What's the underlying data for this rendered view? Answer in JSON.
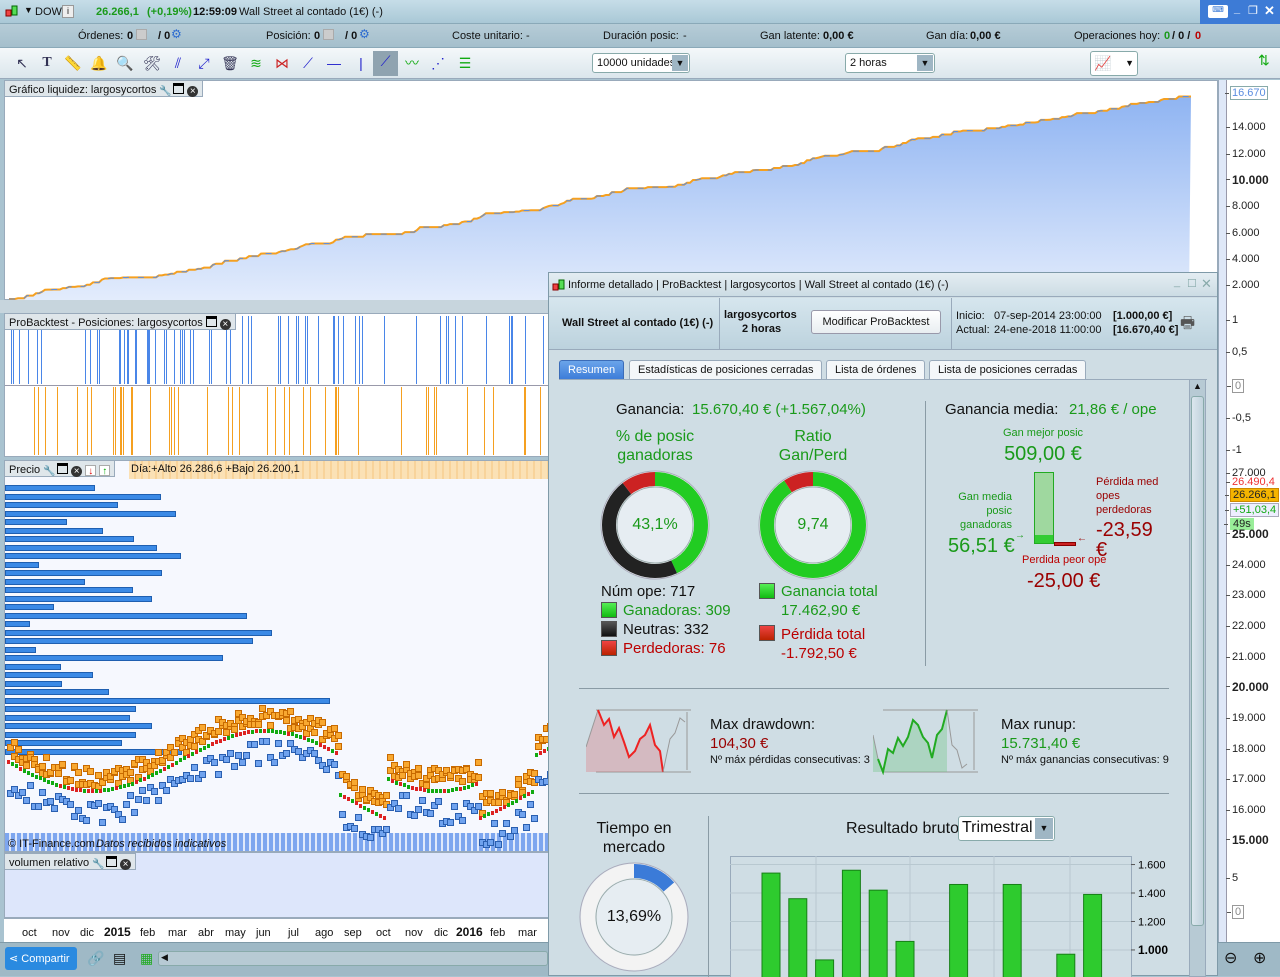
{
  "title_bar": {
    "symbol": "DOW",
    "price": "26.266,1",
    "change": "(+0,19%)",
    "time": "12:59:09",
    "instrument": "Wall Street al contado (1€) (-)"
  },
  "status_bar": {
    "ordenes_label": "Órdenes:",
    "ordenes_value": "0",
    "ordenes_total": "/ 0",
    "posicion_label": "Posición:",
    "posicion_value": "0",
    "posicion_total": "/ 0",
    "coste_label": "Coste unitario:",
    "coste_value": "-",
    "duracion_label": "Duración posic:",
    "duracion_value": "-",
    "gan_latente_label": "Gan latente:",
    "gan_latente_value": "0,00 €",
    "gan_dia_label": "Gan día:",
    "gan_dia_value": "0,00 €",
    "operaciones_label": "Operaciones hoy:",
    "ops": [
      "0",
      "/ 0 /",
      "0"
    ]
  },
  "toolbar": {
    "units": "10000 unidades",
    "timeframe": "2 horas"
  },
  "panels": {
    "equity_title": "Gráfico liquidez: largosycortos",
    "positions_title": "ProBacktest - Posiciones: largosycortos",
    "price_title": "Precio",
    "price_info": "Día:+Alto 26.286,6 +Bajo 26.200,1",
    "copyright": "© IT-Finance.com",
    "data_note": "Datos recibidos indicativos",
    "volume_title": "volumen relativo"
  },
  "axes": {
    "equity": [
      "16.670",
      "14.000",
      "12.000",
      "10.000",
      "8.000",
      "6.000",
      "4.000",
      "2.000"
    ],
    "positions": [
      "1",
      "0,5",
      "0",
      "-0,5",
      "-1"
    ],
    "price": [
      "27.000",
      "26.490,4",
      "26.266,1",
      "+51,03,4",
      "49s",
      "25.000",
      "24.000",
      "23.000",
      "22.000",
      "21.000",
      "20.000",
      "19.000",
      "18.000",
      "17.000",
      "16.000",
      "15.000"
    ],
    "volume": [
      "5",
      "0"
    ],
    "dates": [
      "oct",
      "nov",
      "dic",
      "2015",
      "feb",
      "mar",
      "abr",
      "may",
      "jun",
      "jul",
      "ago",
      "sep",
      "oct",
      "nov",
      "dic",
      "2016",
      "feb",
      "mar"
    ]
  },
  "bottom_bar": {
    "share_label": "Compartir"
  },
  "report": {
    "title": "Informe detallado | ProBacktest | largosycortos | Wall Street al contado (1€) (-)",
    "instrument": "Wall Street al contado (1€) (-)",
    "system": "largosycortos",
    "timeframe": "2 horas",
    "modify_button": "Modificar ProBacktest",
    "inicio_label": "Inicio:",
    "inicio_date": "07-sep-2014 23:00:00",
    "inicio_value": "[1.000,00 €]",
    "actual_label": "Actual:",
    "actual_date": "24-ene-2018 11:00:00",
    "actual_value": "[16.670,40 €]",
    "tabs": [
      "Resumen",
      "Estadísticas de posiciones cerradas",
      "Lista de órdenes",
      "Lista de posiciones cerradas"
    ],
    "ganancia_label": "Ganancia:",
    "ganancia_value": "15.670,40 € (+1.567,04%)",
    "pct_title_1": "% de posic",
    "pct_title_2": "ganadoras",
    "pct_value": "43,1%",
    "ratio_title_1": "Ratio",
    "ratio_title_2": "Gan/Perd",
    "ratio_value": "9,74",
    "num_ope": "Núm ope: 717",
    "ganadoras": "Ganadoras: 309",
    "neutras": "Neutras: 332",
    "perdedoras": "Perdedoras: 76",
    "counts": {
      "ganadoras": 309,
      "neutras": 332,
      "perdedoras": 76
    },
    "ganancia_total_label": "Ganancia total",
    "ganancia_total_value": "17.462,90 €",
    "perdida_total_label": "Pérdida total",
    "perdida_total_value": "-1.792,50 €",
    "ganancia_media_label": "Ganancia media:",
    "ganancia_media_value": "21,86 € / ope",
    "gan_mejor_label": "Gan mejor posic",
    "gan_mejor_value": "509,00 €",
    "gan_media_label": [
      "Gan media",
      "posic",
      "ganadoras"
    ],
    "gan_media_value": "56,51 €",
    "perdida_med_label": [
      "Pérdida med",
      "opes",
      "perdedoras"
    ],
    "perdida_med_value": "-23,59 €",
    "perdida_peor_label": "Perdida peor ope",
    "perdida_peor_value": "-25,00 €",
    "drawdown_label": "Max drawdown:",
    "drawdown_value": "104,30 €",
    "drawdown_sub": "Nº máx pérdidas consecutivas: 3",
    "runup_label": "Max runup:",
    "runup_value": "15.731,40 €",
    "runup_sub": "Nº máx ganancias consecutivas: 9",
    "tiempo_title_1": "Tiempo en",
    "tiempo_title_2": "mercado",
    "tiempo_value": "13,69%",
    "tiempo_pct": 13.69,
    "resultado_label": "Resultado bruto",
    "resultado_period": "Trimestral"
  },
  "chart_data": {
    "type": "bar",
    "title": "Resultado bruto",
    "period": "Trimestral",
    "values": [
      1540,
      1360,
      930,
      1560,
      1420,
      1060,
      null,
      1460,
      null,
      1460,
      null,
      970,
      1390
    ],
    "ylim": [
      810,
      1660
    ],
    "yticks": [
      "1.600",
      "1.400",
      "1.200",
      "1.000"
    ]
  },
  "colors": {
    "green": "#1a9a1a",
    "red": "#b00000",
    "accent": "#3b7bd8",
    "orange": "#f5a020"
  }
}
